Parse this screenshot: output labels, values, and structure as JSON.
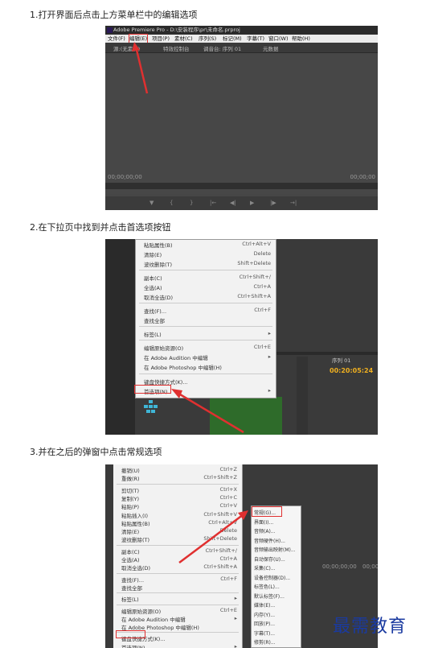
{
  "steps": [
    "1.打开界面后点击上方菜单栏中的编辑选项",
    "2.在下拉页中找到并点击首选项按钮",
    "3.并在之后的弹窗中点击常规选项"
  ],
  "shot1": {
    "title": "Adobe Premiere Pro - D:\\安装程序\\pr\\未命名.prproj",
    "menu": [
      "文件(F)",
      "编辑(E)",
      "项目(P)",
      "素材(C)",
      "序列(S)",
      "标记(M)",
      "字幕(T)",
      "窗口(W)",
      "帮助(H)"
    ],
    "tabs": [
      "源:(无素材)",
      "特效控制台",
      "调音台: 序列 01",
      "元数据"
    ],
    "timecode_left": "00;00;00;00",
    "timecode_right": "00;00;00"
  },
  "shot2": {
    "menu_items": [
      {
        "label": "粘贴属性(B)",
        "key": "Ctrl+Alt+V"
      },
      {
        "label": "清除(E)",
        "key": "Delete"
      },
      {
        "label": "波纹删除(T)",
        "key": "Shift+Delete"
      },
      {
        "label": "副本(C)",
        "key": "Ctrl+Shift+/"
      },
      {
        "label": "全选(A)",
        "key": "Ctrl+A"
      },
      {
        "label": "取消全选(D)",
        "key": "Ctrl+Shift+A"
      },
      {
        "label": "查找(F)...",
        "key": "Ctrl+F"
      },
      {
        "label": "查找全部",
        "key": ""
      },
      {
        "label": "标签(L)",
        "key": "▸"
      },
      {
        "label": "编辑原始资源(O)",
        "key": "Ctrl+E"
      },
      {
        "label": "在 Adobe Audition 中编辑",
        "key": "▸"
      },
      {
        "label": "在 Adobe Photoshop 中编辑(H)",
        "key": ""
      },
      {
        "label": "键盘快捷方式(K)...",
        "key": ""
      },
      {
        "label": "首选项(N)",
        "key": "▸"
      }
    ],
    "timecode": "00:20:05:24",
    "panel_tab": "序列 01"
  },
  "shot3": {
    "menu_items": [
      {
        "label": "撤销(U)",
        "key": "Ctrl+Z"
      },
      {
        "label": "重做(R)",
        "key": "Ctrl+Shift+Z"
      },
      {
        "label": "剪切(T)",
        "key": "Ctrl+X"
      },
      {
        "label": "复制(Y)",
        "key": "Ctrl+C"
      },
      {
        "label": "粘贴(P)",
        "key": "Ctrl+V"
      },
      {
        "label": "粘贴插入(I)",
        "key": "Ctrl+Shift+V"
      },
      {
        "label": "粘贴属性(B)",
        "key": "Ctrl+Alt+V"
      },
      {
        "label": "清除(E)",
        "key": "Delete"
      },
      {
        "label": "波纹删除(T)",
        "key": "Shift+Delete"
      },
      {
        "label": "副本(C)",
        "key": "Ctrl+Shift+/"
      },
      {
        "label": "全选(A)",
        "key": "Ctrl+A"
      },
      {
        "label": "取消全选(D)",
        "key": "Ctrl+Shift+A"
      },
      {
        "label": "查找(F)...",
        "key": "Ctrl+F"
      },
      {
        "label": "查找全部",
        "key": ""
      },
      {
        "label": "标签(L)",
        "key": "▸"
      },
      {
        "label": "编辑原始资源(O)",
        "key": "Ctrl+E"
      },
      {
        "label": "在 Adobe Audition 中编辑",
        "key": "▸"
      },
      {
        "label": "在 Adobe Photoshop 中编辑(H)",
        "key": ""
      },
      {
        "label": "键盘快捷方式(K)...",
        "key": ""
      },
      {
        "label": "首选项(N)",
        "key": "▸"
      }
    ],
    "submenu": [
      "常规(G)...",
      "界面(I)...",
      "音频(A)...",
      "音频硬件(H)...",
      "音频输出映射(M)...",
      "自动保存(U)...",
      "采集(C)...",
      "设备控制器(D)...",
      "标签色(L)...",
      "默认标签(F)...",
      "媒体(E)...",
      "内存(Y)...",
      "回放(P)...",
      "字幕(T)...",
      "修剪(R)..."
    ],
    "timecode_left": "00;00;00;00",
    "timecode_right": "00;00"
  },
  "watermark": "最需教育"
}
